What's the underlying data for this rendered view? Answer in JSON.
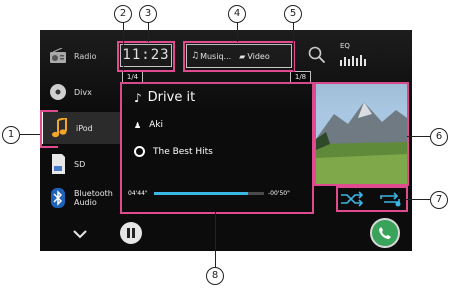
{
  "sources": [
    {
      "label": "Radio",
      "icon": "radio-icon"
    },
    {
      "label": "Divx",
      "icon": "disc-icon"
    },
    {
      "label": "iPod",
      "icon": "music-note-icon",
      "active": true
    },
    {
      "label": "SD",
      "icon": "sd-card-icon"
    },
    {
      "label": "Bluetooth Audio",
      "icon": "bluetooth-icon"
    }
  ],
  "topbar": {
    "clock": "11:23",
    "tab_music": "Musiq...",
    "tab_video": "Video",
    "eq_label": "EQ"
  },
  "counters": {
    "left": "1/4",
    "right": "1/8"
  },
  "track": {
    "title": "Drive it",
    "artist": "Aki",
    "album": "The Best Hits",
    "elapsed": "04'44\"",
    "remaining": "-00'50\"",
    "progress": 0.85
  },
  "callouts": [
    "1",
    "2",
    "3",
    "4",
    "5",
    "6",
    "7",
    "8"
  ],
  "colors": {
    "highlight": "#e04a8f",
    "accent": "#3bb7e6",
    "phone": "#3aa35a"
  }
}
